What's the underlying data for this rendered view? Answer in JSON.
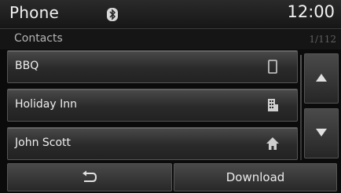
{
  "header": {
    "title": "Phone",
    "bluetooth_icon": "bluetooth-icon",
    "time": "12:00"
  },
  "subheader": {
    "title": "Contacts",
    "page_counter": "1/112"
  },
  "contacts": [
    {
      "name": "BBQ",
      "icon": "mobile-phone-icon"
    },
    {
      "name": "Holiday Inn",
      "icon": "office-building-icon"
    },
    {
      "name": "John Scott",
      "icon": "home-icon"
    }
  ],
  "scroll": {
    "up_icon": "arrow-up-icon",
    "down_icon": "arrow-down-icon"
  },
  "footer": {
    "back_icon": "back-arrow-icon",
    "download_label": "Download"
  }
}
